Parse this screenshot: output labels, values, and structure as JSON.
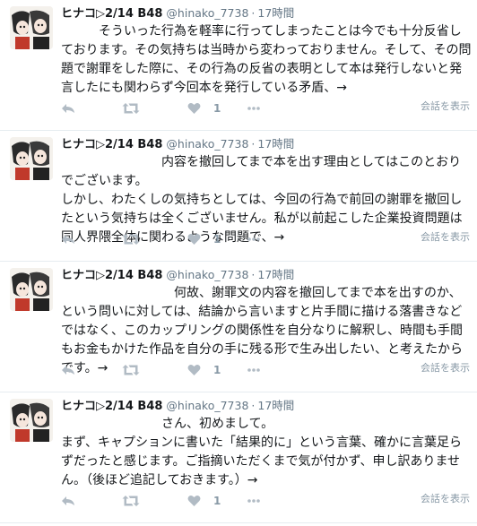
{
  "colors": {
    "icon": "#b1bbc4",
    "muted": "#657786",
    "divider": "#e6ecf0"
  },
  "tweets": [
    {
      "name": "ヒナコ▷2/14 B48",
      "handle": "@hinako_7738",
      "time": "17時間",
      "text": "　　　そういった行為を軽率に行ってしまったことは今でも十分反省しております。その気持ちは当時から変わっておりません。そして、その問題で謝罪をした際に、その行為の反省の表明として本は発行しないと発言したにも関わらず今回本を発行している矛盾、→",
      "likes": "1",
      "convo": "会話を表示"
    },
    {
      "name": "ヒナコ▷2/14 B48",
      "handle": "@hinako_7738",
      "time": "17時間",
      "text": "　　　　　　　　内容を撤回してまで本を出す理由としてはこのとおりでございます。\nしかし、わたくしの気持ちとしては、今回の行為で前回の謝罪を撤回したという気持ちは全くございません。私が以前起こした企業投資問題は同人界隈全体に関わるような問題で、→",
      "likes": "1",
      "convo": "会話を表示"
    },
    {
      "name": "ヒナコ▷2/14 B48",
      "handle": "@hinako_7738",
      "time": "17時間",
      "text": "　　　　　　　　　何故、謝罪文の内容を撤回してまで本を出すのか、という問いに対しては、結論から言いますと片手間に描ける落書きなどではなく、このカップリングの関係性を自分なりに解釈し、時間も手間もお金もかけた作品を自分の手に残る形で生み出したい、と考えたからです。→",
      "likes": "1",
      "convo": "会話を表示"
    },
    {
      "name": "ヒナコ▷2/14 B48",
      "handle": "@hinako_7738",
      "time": "17時間",
      "text": "　　　　　　　　さん、初めまして。\nまず、キャプションに書いた「結果的に」という言葉、確かに言葉足らずだったと感じます。ご指摘いただくまで気が付かず、申し訳ありません。（後ほど追記しておきます。）→",
      "likes": "1",
      "convo": "会話を表示"
    }
  ]
}
